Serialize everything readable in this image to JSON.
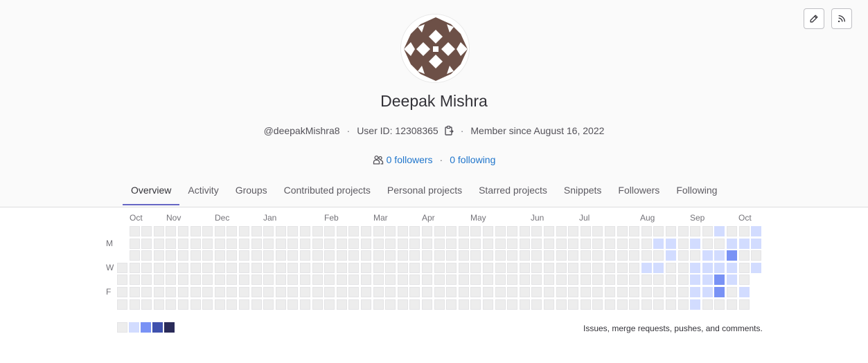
{
  "profile": {
    "name": "Deepak Mishra",
    "username": "@deepakMishra8",
    "user_id": "User ID: 12308365",
    "member_since": "Member since August 16, 2022",
    "followers": "0 followers",
    "following": "0 following"
  },
  "actions": {
    "edit_icon": "pencil-icon",
    "rss_icon": "rss-icon"
  },
  "tabs": [
    {
      "label": "Overview",
      "active": true
    },
    {
      "label": "Activity"
    },
    {
      "label": "Groups"
    },
    {
      "label": "Contributed projects"
    },
    {
      "label": "Personal projects"
    },
    {
      "label": "Starred projects"
    },
    {
      "label": "Snippets"
    },
    {
      "label": "Followers"
    },
    {
      "label": "Following"
    }
  ],
  "calendar": {
    "months": [
      "Oct",
      "Nov",
      "Dec",
      "Jan",
      "Feb",
      "Mar",
      "Apr",
      "May",
      "Jun",
      "Jul",
      "Aug",
      "Sep",
      "Oct"
    ],
    "day_labels": [
      "M",
      "W",
      "F"
    ],
    "legend_caption": "Issues, merge requests, pushes, and comments.",
    "colors": [
      "#ededed",
      "#d2dcff",
      "#7992f5",
      "#3f51ae",
      "#2a2b59"
    ],
    "activity": [
      {
        "week": 47,
        "day": 3,
        "level": 1
      },
      {
        "week": 48,
        "day": 1,
        "level": 1
      },
      {
        "week": 48,
        "day": 3,
        "level": 1
      },
      {
        "week": 49,
        "day": 1,
        "level": 1
      },
      {
        "week": 49,
        "day": 2,
        "level": 1
      },
      {
        "week": 51,
        "day": 1,
        "level": 1
      },
      {
        "week": 51,
        "day": 3,
        "level": 1
      },
      {
        "week": 51,
        "day": 4,
        "level": 1
      },
      {
        "week": 51,
        "day": 5,
        "level": 1
      },
      {
        "week": 51,
        "day": 6,
        "level": 1
      },
      {
        "week": 52,
        "day": 2,
        "level": 1
      },
      {
        "week": 52,
        "day": 3,
        "level": 1
      },
      {
        "week": 52,
        "day": 4,
        "level": 1
      },
      {
        "week": 52,
        "day": 5,
        "level": 1
      },
      {
        "week": 53,
        "day": 0,
        "level": 1
      },
      {
        "week": 53,
        "day": 2,
        "level": 1
      },
      {
        "week": 53,
        "day": 3,
        "level": 1
      },
      {
        "week": 53,
        "day": 4,
        "level": 2
      },
      {
        "week": 53,
        "day": 5,
        "level": 2
      },
      {
        "week": 54,
        "day": 1,
        "level": 1
      },
      {
        "week": 54,
        "day": 2,
        "level": 2
      },
      {
        "week": 54,
        "day": 3,
        "level": 1
      },
      {
        "week": 54,
        "day": 4,
        "level": 1
      },
      {
        "week": 55,
        "day": 1,
        "level": 1
      },
      {
        "week": 55,
        "day": 5,
        "level": 1
      },
      {
        "week": 56,
        "day": 0,
        "level": 1
      },
      {
        "week": 56,
        "day": 1,
        "level": 1
      },
      {
        "week": 56,
        "day": 3,
        "level": 1
      }
    ]
  }
}
